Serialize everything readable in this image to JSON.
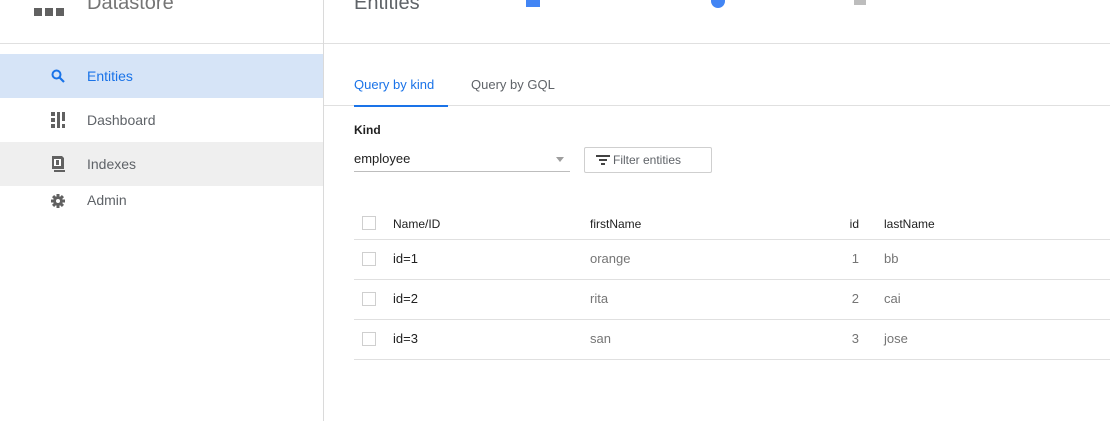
{
  "sidebar": {
    "product_title": "Datastore",
    "items": [
      {
        "label": "Entities",
        "icon": "search-icon",
        "active": true
      },
      {
        "label": "Dashboard",
        "icon": "dashboard-icon",
        "active": false
      },
      {
        "label": "Indexes",
        "icon": "indexes-icon",
        "active": false
      },
      {
        "label": "Admin",
        "icon": "gear-icon",
        "active": false
      }
    ]
  },
  "header": {
    "title": "Entities"
  },
  "tabs": [
    {
      "label": "Query by kind",
      "active": true
    },
    {
      "label": "Query by GQL",
      "active": false
    }
  ],
  "query": {
    "kind_label": "Kind",
    "kind_value": "employee",
    "filter_label": "Filter entities"
  },
  "table": {
    "columns": [
      "Name/ID",
      "firstName",
      "id",
      "lastName"
    ],
    "rows": [
      {
        "name": "id=1",
        "firstName": "orange",
        "id": "1",
        "lastName": "bb"
      },
      {
        "name": "id=2",
        "firstName": "rita",
        "id": "2",
        "lastName": "cai"
      },
      {
        "name": "id=3",
        "firstName": "san",
        "id": "3",
        "lastName": "jose"
      }
    ]
  },
  "colors": {
    "accent": "#1a73e8",
    "active_nav_bg": "#d6e4f7",
    "icon": "#616161"
  }
}
